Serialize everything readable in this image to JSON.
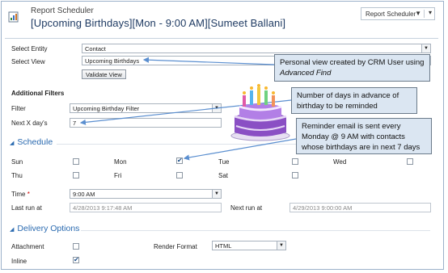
{
  "header": {
    "subtitle": "Report Scheduler",
    "title": "[Upcoming Birthdays][Mon - 9:00 AM][Sumeet Ballani]",
    "nav_dropdown": "Report Scheduler"
  },
  "general": {
    "entity_label": "Select Entity",
    "entity_value": "Contact",
    "view_label": "Select View",
    "view_value": "Upcoming Birthdays",
    "validate_button": "Validate View"
  },
  "filters": {
    "section_label": "Additional Filters",
    "filter_label": "Filter",
    "filter_value": "Upcoming Birthday Filter",
    "days_label": "Next X day's",
    "days_value": "7"
  },
  "schedule": {
    "section_label": "Schedule",
    "days": [
      {
        "label": "Sun",
        "checked": false
      },
      {
        "label": "Mon",
        "checked": true
      },
      {
        "label": "Tue",
        "checked": false
      },
      {
        "label": "Wed",
        "checked": false
      },
      {
        "label": "Thu",
        "checked": false
      },
      {
        "label": "Fri",
        "checked": false
      },
      {
        "label": "Sat",
        "checked": false
      }
    ],
    "time_label": "Time",
    "time_required": "*",
    "time_value": "9:00 AM",
    "last_run_label": "Last run at",
    "last_run_value": "4/28/2013 9:17:48 AM",
    "next_run_label": "Next run at",
    "next_run_value": "4/29/2013 9:00:00 AM"
  },
  "delivery": {
    "section_label": "Delivery Options",
    "attachment_label": "Attachment",
    "attachment_checked": false,
    "render_label": "Render Format",
    "render_value": "HTML",
    "inline_label": "Inline",
    "inline_checked": true
  },
  "callouts": {
    "personal_view_line1": "Personal view created by CRM User using",
    "personal_view_line2": "Advanced Find",
    "days_advance_line1": "Number of days in advance of",
    "days_advance_line2": "birthday to be reminded",
    "reminder_line1": "Reminder email is sent every",
    "reminder_line2": "Monday @ 9 AM with contacts",
    "reminder_line3": "whose birthdays are in next 7 days"
  },
  "icons": {
    "report": "report-icon",
    "cake": "birthday-cake-icon",
    "check": "✔",
    "caret": "▼",
    "section_triangle": "◢"
  },
  "colors": {
    "section_blue": "#2a6ab0",
    "title_navy": "#1f3b63",
    "callout_bg": "#dbe6f2",
    "arrow_blue": "#5b8fd0"
  }
}
